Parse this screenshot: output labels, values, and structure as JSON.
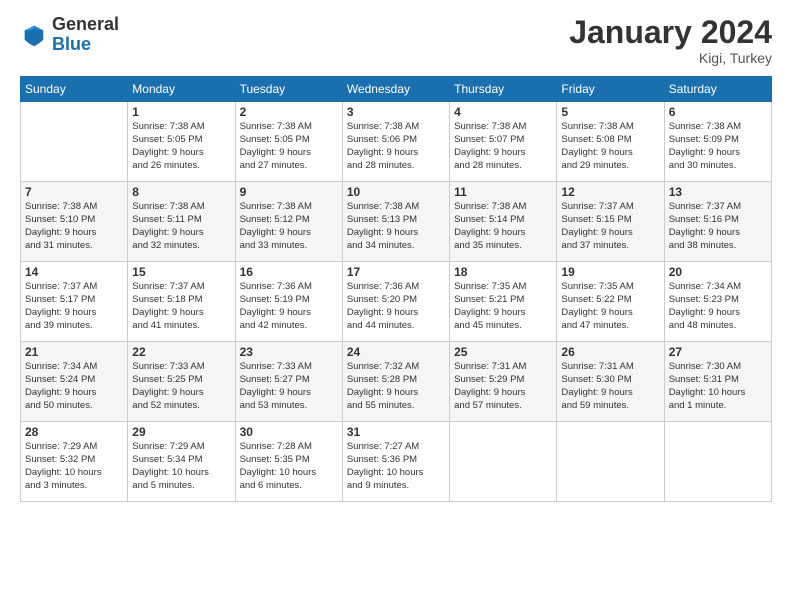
{
  "logo": {
    "general": "General",
    "blue": "Blue"
  },
  "header": {
    "title": "January 2024",
    "location": "Kigi, Turkey"
  },
  "weekdays": [
    "Sunday",
    "Monday",
    "Tuesday",
    "Wednesday",
    "Thursday",
    "Friday",
    "Saturday"
  ],
  "weeks": [
    [
      {
        "day": "",
        "info": ""
      },
      {
        "day": "1",
        "info": "Sunrise: 7:38 AM\nSunset: 5:05 PM\nDaylight: 9 hours\nand 26 minutes."
      },
      {
        "day": "2",
        "info": "Sunrise: 7:38 AM\nSunset: 5:05 PM\nDaylight: 9 hours\nand 27 minutes."
      },
      {
        "day": "3",
        "info": "Sunrise: 7:38 AM\nSunset: 5:06 PM\nDaylight: 9 hours\nand 28 minutes."
      },
      {
        "day": "4",
        "info": "Sunrise: 7:38 AM\nSunset: 5:07 PM\nDaylight: 9 hours\nand 28 minutes."
      },
      {
        "day": "5",
        "info": "Sunrise: 7:38 AM\nSunset: 5:08 PM\nDaylight: 9 hours\nand 29 minutes."
      },
      {
        "day": "6",
        "info": "Sunrise: 7:38 AM\nSunset: 5:09 PM\nDaylight: 9 hours\nand 30 minutes."
      }
    ],
    [
      {
        "day": "7",
        "info": "Sunrise: 7:38 AM\nSunset: 5:10 PM\nDaylight: 9 hours\nand 31 minutes."
      },
      {
        "day": "8",
        "info": "Sunrise: 7:38 AM\nSunset: 5:11 PM\nDaylight: 9 hours\nand 32 minutes."
      },
      {
        "day": "9",
        "info": "Sunrise: 7:38 AM\nSunset: 5:12 PM\nDaylight: 9 hours\nand 33 minutes."
      },
      {
        "day": "10",
        "info": "Sunrise: 7:38 AM\nSunset: 5:13 PM\nDaylight: 9 hours\nand 34 minutes."
      },
      {
        "day": "11",
        "info": "Sunrise: 7:38 AM\nSunset: 5:14 PM\nDaylight: 9 hours\nand 35 minutes."
      },
      {
        "day": "12",
        "info": "Sunrise: 7:37 AM\nSunset: 5:15 PM\nDaylight: 9 hours\nand 37 minutes."
      },
      {
        "day": "13",
        "info": "Sunrise: 7:37 AM\nSunset: 5:16 PM\nDaylight: 9 hours\nand 38 minutes."
      }
    ],
    [
      {
        "day": "14",
        "info": "Sunrise: 7:37 AM\nSunset: 5:17 PM\nDaylight: 9 hours\nand 39 minutes."
      },
      {
        "day": "15",
        "info": "Sunrise: 7:37 AM\nSunset: 5:18 PM\nDaylight: 9 hours\nand 41 minutes."
      },
      {
        "day": "16",
        "info": "Sunrise: 7:36 AM\nSunset: 5:19 PM\nDaylight: 9 hours\nand 42 minutes."
      },
      {
        "day": "17",
        "info": "Sunrise: 7:36 AM\nSunset: 5:20 PM\nDaylight: 9 hours\nand 44 minutes."
      },
      {
        "day": "18",
        "info": "Sunrise: 7:35 AM\nSunset: 5:21 PM\nDaylight: 9 hours\nand 45 minutes."
      },
      {
        "day": "19",
        "info": "Sunrise: 7:35 AM\nSunset: 5:22 PM\nDaylight: 9 hours\nand 47 minutes."
      },
      {
        "day": "20",
        "info": "Sunrise: 7:34 AM\nSunset: 5:23 PM\nDaylight: 9 hours\nand 48 minutes."
      }
    ],
    [
      {
        "day": "21",
        "info": "Sunrise: 7:34 AM\nSunset: 5:24 PM\nDaylight: 9 hours\nand 50 minutes."
      },
      {
        "day": "22",
        "info": "Sunrise: 7:33 AM\nSunset: 5:25 PM\nDaylight: 9 hours\nand 52 minutes."
      },
      {
        "day": "23",
        "info": "Sunrise: 7:33 AM\nSunset: 5:27 PM\nDaylight: 9 hours\nand 53 minutes."
      },
      {
        "day": "24",
        "info": "Sunrise: 7:32 AM\nSunset: 5:28 PM\nDaylight: 9 hours\nand 55 minutes."
      },
      {
        "day": "25",
        "info": "Sunrise: 7:31 AM\nSunset: 5:29 PM\nDaylight: 9 hours\nand 57 minutes."
      },
      {
        "day": "26",
        "info": "Sunrise: 7:31 AM\nSunset: 5:30 PM\nDaylight: 9 hours\nand 59 minutes."
      },
      {
        "day": "27",
        "info": "Sunrise: 7:30 AM\nSunset: 5:31 PM\nDaylight: 10 hours\nand 1 minute."
      }
    ],
    [
      {
        "day": "28",
        "info": "Sunrise: 7:29 AM\nSunset: 5:32 PM\nDaylight: 10 hours\nand 3 minutes."
      },
      {
        "day": "29",
        "info": "Sunrise: 7:29 AM\nSunset: 5:34 PM\nDaylight: 10 hours\nand 5 minutes."
      },
      {
        "day": "30",
        "info": "Sunrise: 7:28 AM\nSunset: 5:35 PM\nDaylight: 10 hours\nand 6 minutes."
      },
      {
        "day": "31",
        "info": "Sunrise: 7:27 AM\nSunset: 5:36 PM\nDaylight: 10 hours\nand 9 minutes."
      },
      {
        "day": "",
        "info": ""
      },
      {
        "day": "",
        "info": ""
      },
      {
        "day": "",
        "info": ""
      }
    ]
  ]
}
